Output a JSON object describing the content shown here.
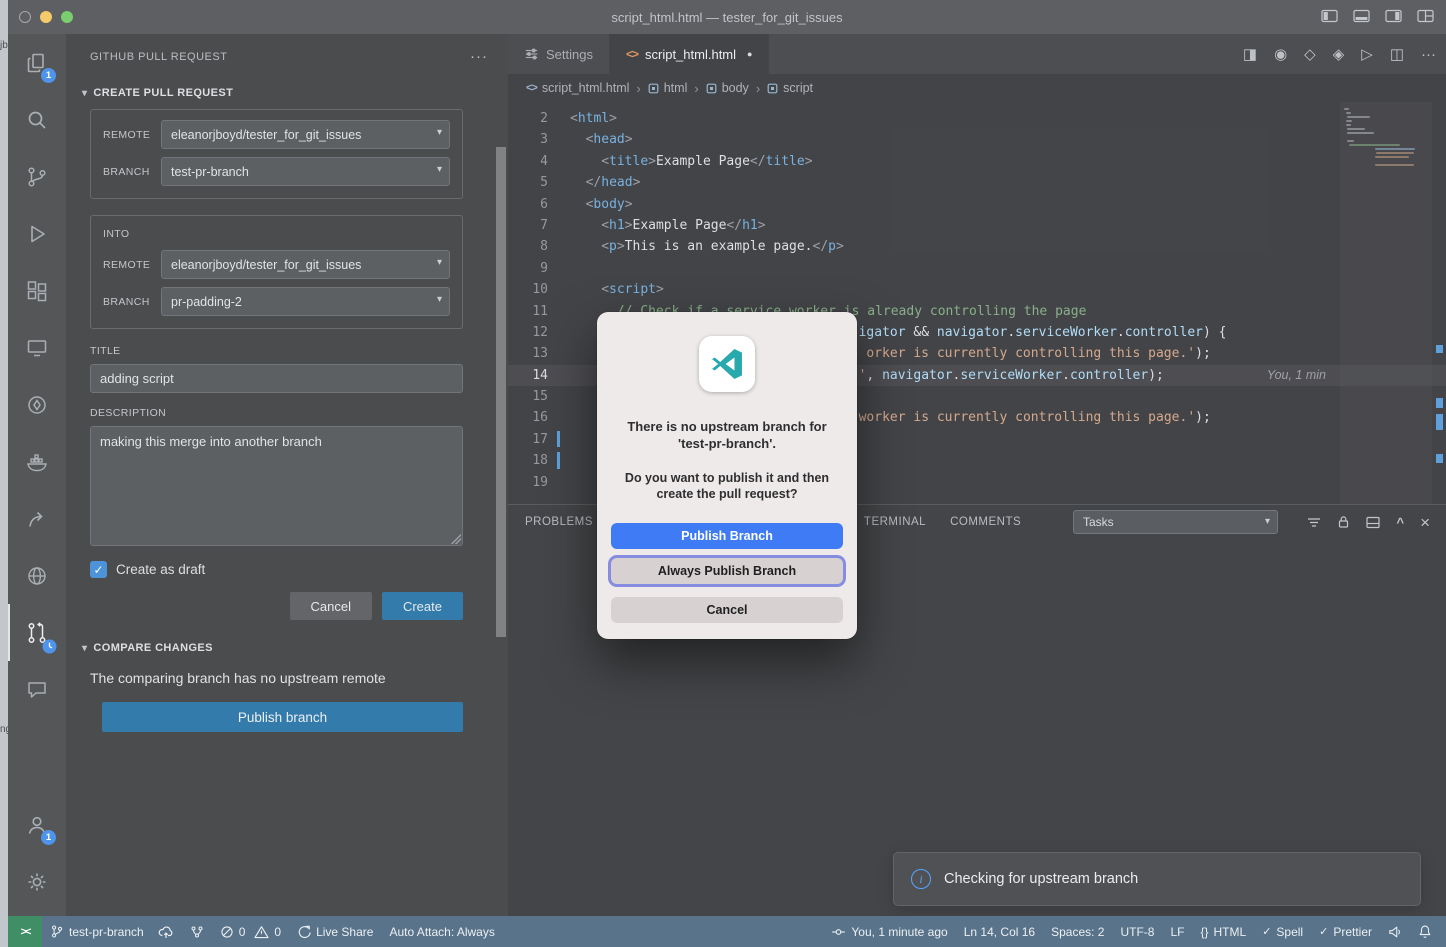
{
  "background": {
    "fragment1": "jb",
    "fragment2": "ng"
  },
  "title_bar": {
    "title": "script_html.html — tester_for_git_issues"
  },
  "activity_bar": {
    "explorer_badge": "1",
    "accounts_badge": "1"
  },
  "sidebar": {
    "title": "GITHUB PULL REQUEST",
    "create_section": "CREATE PULL REQUEST",
    "labels": {
      "remote": "REMOTE",
      "branch": "BRANCH",
      "into": "INTO",
      "title": "TITLE",
      "description": "DESCRIPTION"
    },
    "from_remote": "eleanorjboyd/tester_for_git_issues",
    "from_branch": "test-pr-branch",
    "into_remote": "eleanorjboyd/tester_for_git_issues",
    "into_branch": "pr-padding-2",
    "title_value": "adding script",
    "description_value": "making this merge into another branch",
    "draft_checkbox": "Create as draft",
    "cancel_button": "Cancel",
    "create_button": "Create",
    "compare_section": "COMPARE CHANGES",
    "compare_message": "The comparing branch has no upstream remote",
    "publish_button": "Publish branch"
  },
  "editor": {
    "tabs": [
      {
        "label": "Settings"
      },
      {
        "label": "script_html.html"
      }
    ],
    "breadcrumb": [
      "script_html.html",
      "html",
      "body",
      "script"
    ],
    "blame": "You, 1 min",
    "code_lines": [
      {
        "n": 2,
        "i": 0,
        "t": [
          [
            "pu",
            "<"
          ],
          [
            "tg",
            "html"
          ],
          [
            "pu",
            ">"
          ]
        ]
      },
      {
        "n": 3,
        "i": 2,
        "t": [
          [
            "pu",
            "<"
          ],
          [
            "tg",
            "head"
          ],
          [
            "pu",
            ">"
          ]
        ]
      },
      {
        "n": 4,
        "i": 4,
        "t": [
          [
            "pu",
            "<"
          ],
          [
            "tg",
            "title"
          ],
          [
            "pu",
            ">"
          ],
          [
            "pl",
            "Example Page"
          ],
          [
            "pu",
            "</"
          ],
          [
            "tg",
            "title"
          ],
          [
            "pu",
            ">"
          ]
        ]
      },
      {
        "n": 5,
        "i": 2,
        "t": [
          [
            "pu",
            "</"
          ],
          [
            "tg",
            "head"
          ],
          [
            "pu",
            ">"
          ]
        ]
      },
      {
        "n": 6,
        "i": 2,
        "t": [
          [
            "pu",
            "<"
          ],
          [
            "tg",
            "body"
          ],
          [
            "pu",
            ">"
          ]
        ]
      },
      {
        "n": 7,
        "i": 4,
        "t": [
          [
            "pu",
            "<"
          ],
          [
            "tg",
            "h1"
          ],
          [
            "pu",
            ">"
          ],
          [
            "pl",
            "Example Page"
          ],
          [
            "pu",
            "</"
          ],
          [
            "tg",
            "h1"
          ],
          [
            "pu",
            ">"
          ]
        ]
      },
      {
        "n": 8,
        "i": 4,
        "t": [
          [
            "pu",
            "<"
          ],
          [
            "tg",
            "p"
          ],
          [
            "pu",
            ">"
          ],
          [
            "pl",
            "This is an example page."
          ],
          [
            "pu",
            "</"
          ],
          [
            "tg",
            "p"
          ],
          [
            "pu",
            ">"
          ]
        ]
      },
      {
        "n": 9,
        "i": 0,
        "t": []
      },
      {
        "n": 10,
        "i": 4,
        "t": [
          [
            "pu",
            "<"
          ],
          [
            "tg",
            "script"
          ],
          [
            "pu",
            ">"
          ]
        ]
      },
      {
        "n": 11,
        "i": 6,
        "t": [
          [
            "cm",
            "// Check if a service worker is already controlling the page"
          ]
        ]
      },
      {
        "n": 12,
        "i": 37,
        "t": [
          [
            "id",
            "igator"
          ],
          [
            "pl",
            " && "
          ],
          [
            "id",
            "navigator"
          ],
          [
            "pl",
            "."
          ],
          [
            "id",
            "serviceWorker"
          ],
          [
            "pl",
            "."
          ],
          [
            "id",
            "controller"
          ],
          [
            "pl",
            ") {"
          ]
        ]
      },
      {
        "n": 13,
        "i": 38,
        "t": [
          [
            "st",
            "orker is currently controlling this page.'"
          ],
          [
            "pl",
            ");"
          ]
        ]
      },
      {
        "n": 14,
        "i": 37,
        "t": [
          [
            "st",
            "'"
          ],
          [
            "pl",
            ", "
          ],
          [
            "id",
            "navigator"
          ],
          [
            "pl",
            "."
          ],
          [
            "id",
            "serviceWorker"
          ],
          [
            "pl",
            "."
          ],
          [
            "id",
            "controller"
          ],
          [
            "pl",
            ");"
          ]
        ],
        "active": true,
        "blame": true
      },
      {
        "n": 15,
        "i": 0,
        "t": []
      },
      {
        "n": 16,
        "i": 37,
        "t": [
          [
            "st",
            "worker is currently controlling this page.'"
          ],
          [
            "pl",
            ");"
          ]
        ]
      },
      {
        "n": 17,
        "i": 0,
        "t": [],
        "mod": true
      },
      {
        "n": 18,
        "i": 0,
        "t": [],
        "mod": true
      },
      {
        "n": 19,
        "i": 0,
        "t": []
      }
    ]
  },
  "panel": {
    "tabs": [
      "PROBLEMS",
      "TERMINAL",
      "COMMENTS"
    ],
    "tasks_label": "Tasks"
  },
  "notification": {
    "message": "Checking for upstream branch"
  },
  "dialog": {
    "message_line1": "There is no upstream branch for 'test-pr-branch'.",
    "message_line2": "Do you want to publish it and then create the pull request?",
    "publish_button": "Publish Branch",
    "always_button": "Always Publish Branch",
    "cancel_button": "Cancel"
  },
  "status_bar": {
    "branch": "test-pr-branch",
    "errors": "0",
    "warnings": "0",
    "live_share": "Live Share",
    "auto_attach": "Auto Attach: Always",
    "commit_info": "You, 1 minute ago",
    "cursor": "Ln 14, Col 16",
    "indentation": "Spaces: 2",
    "encoding": "UTF-8",
    "eol": "LF",
    "language": "HTML",
    "language_icon": "{}",
    "spell": "Spell",
    "prettier": "Prettier"
  },
  "colors": {
    "dialog_primary_blue": "#3e7bf4",
    "badge_blue": "#2f81e8",
    "modified_gutter_blue": "#3f8fd6",
    "remote_indicator_green": "#1d7a4a",
    "statusbar_blue": "#3a5a75"
  }
}
